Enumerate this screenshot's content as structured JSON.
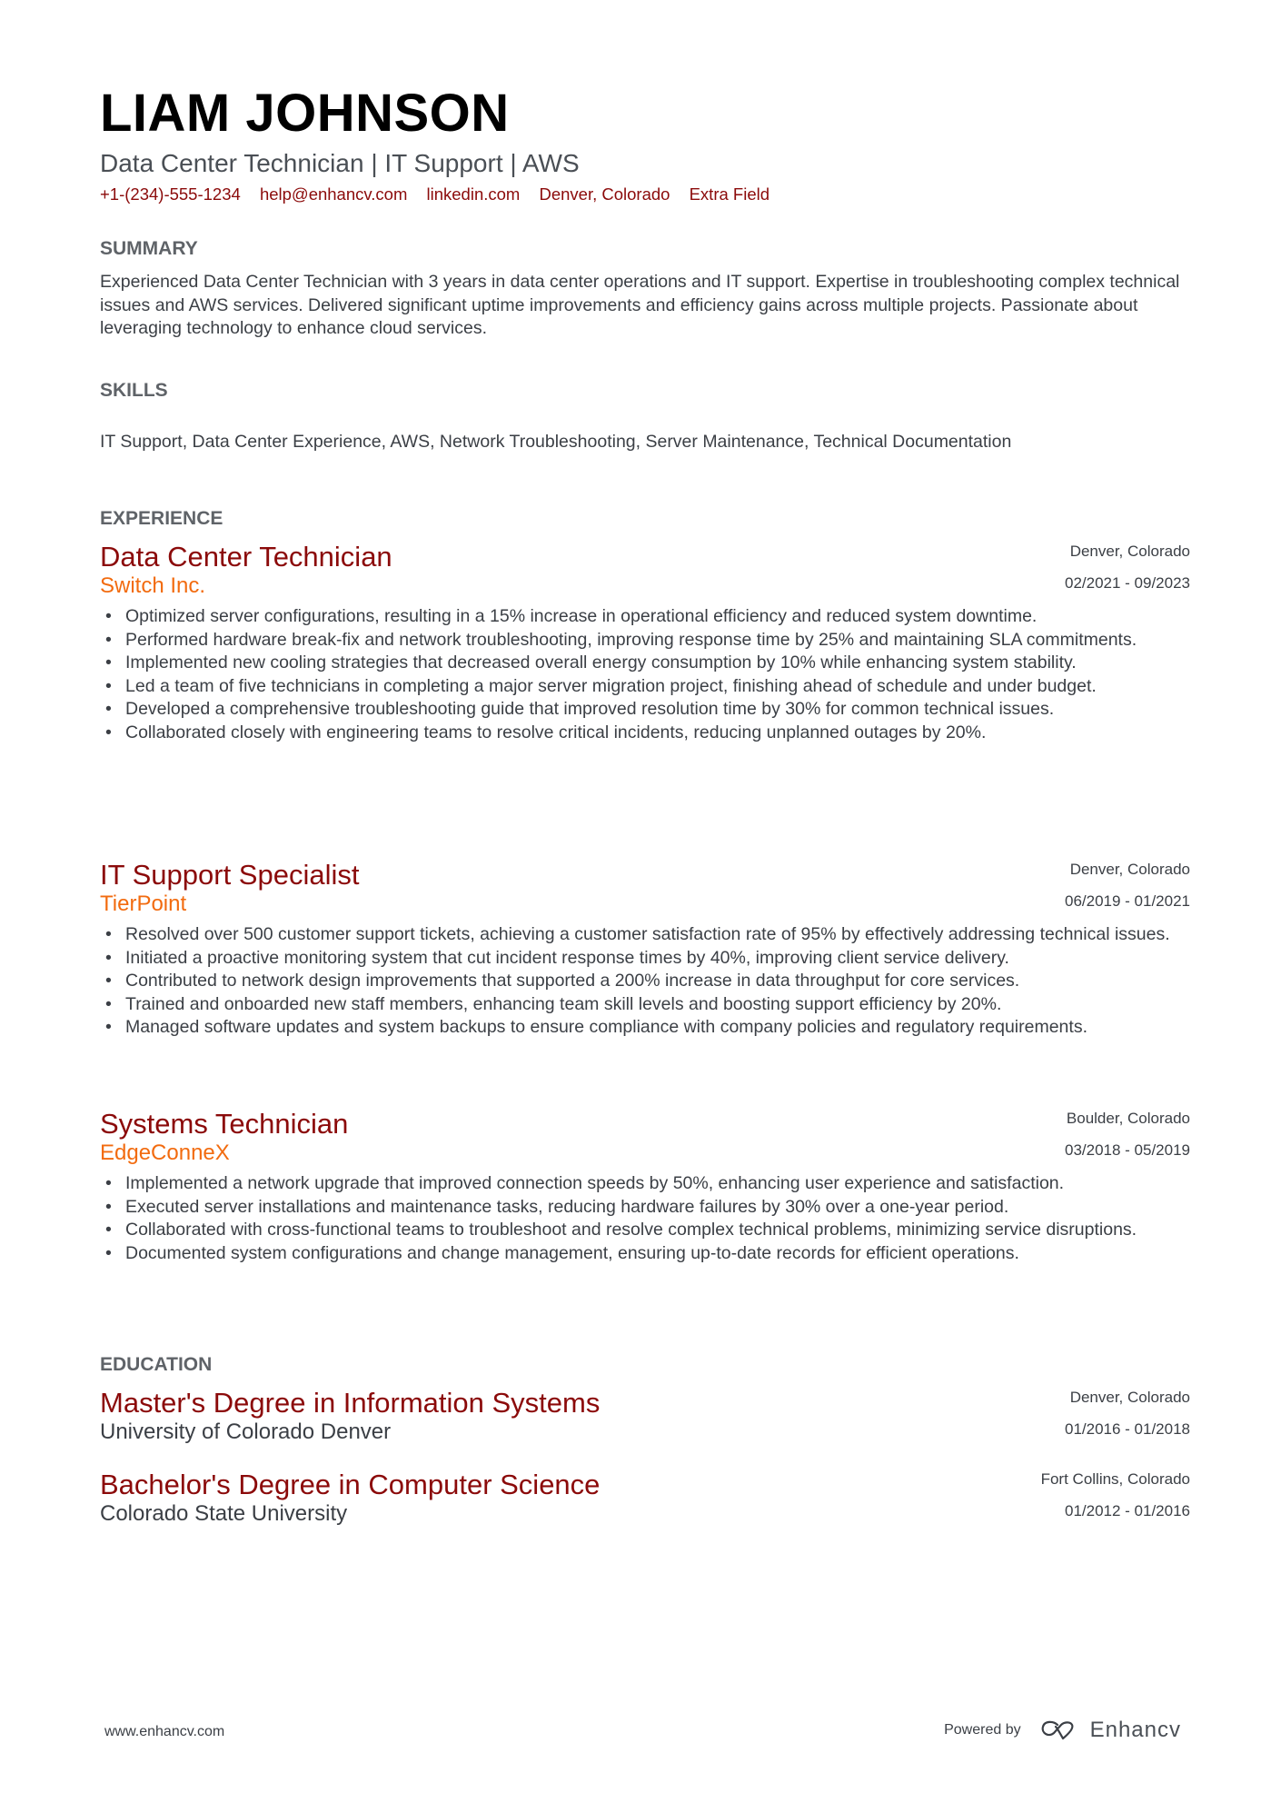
{
  "header": {
    "name": "LIAM JOHNSON",
    "subtitle": "Data Center Technician | IT Support | AWS",
    "contacts": [
      "+1-(234)-555-1234",
      "help@enhancv.com",
      "linkedin.com",
      "Denver, Colorado",
      "Extra Field"
    ]
  },
  "summary": {
    "heading": "SUMMARY",
    "text": "Experienced Data Center Technician with 3 years in data center operations and IT support. Expertise in troubleshooting complex technical issues and AWS services. Delivered significant uptime improvements and efficiency gains across multiple projects. Passionate about leveraging technology to enhance cloud services."
  },
  "skills": {
    "heading": "SKILLS",
    "text": "IT Support, Data Center Experience, AWS, Network Troubleshooting, Server Maintenance, Technical Documentation"
  },
  "experience": {
    "heading": "EXPERIENCE",
    "jobs": [
      {
        "title": "Data Center Technician",
        "company": "Switch Inc.",
        "location": "Denver, Colorado",
        "dates": "02/2021 - 09/2023",
        "bullets": [
          "Optimized server configurations, resulting in a 15% increase in operational efficiency and reduced system downtime.",
          "Performed hardware break-fix and network troubleshooting, improving response time by 25% and maintaining SLA commitments.",
          "Implemented new cooling strategies that decreased overall energy consumption by 10% while enhancing system stability.",
          "Led a team of five technicians in completing a major server migration project, finishing ahead of schedule and under budget.",
          "Developed a comprehensive troubleshooting guide that improved resolution time by 30% for common technical issues.",
          "Collaborated closely with engineering teams to resolve critical incidents, reducing unplanned outages by 20%."
        ]
      },
      {
        "title": "IT Support Specialist",
        "company": "TierPoint",
        "location": "Denver, Colorado",
        "dates": "06/2019 - 01/2021",
        "bullets": [
          "Resolved over 500 customer support tickets, achieving a customer satisfaction rate of 95% by effectively addressing technical issues.",
          "Initiated a proactive monitoring system that cut incident response times by 40%, improving client service delivery.",
          "Contributed to network design improvements that supported a 200% increase in data throughput for core services.",
          "Trained and onboarded new staff members, enhancing team skill levels and boosting support efficiency by 20%.",
          "Managed software updates and system backups to ensure compliance with company policies and regulatory requirements."
        ]
      },
      {
        "title": "Systems Technician",
        "company": "EdgeConneX",
        "location": "Boulder, Colorado",
        "dates": "03/2018 - 05/2019",
        "bullets": [
          "Implemented a network upgrade that improved connection speeds by 50%, enhancing user experience and satisfaction.",
          "Executed server installations and maintenance tasks, reducing hardware failures by 30% over a one-year period.",
          "Collaborated with cross-functional teams to troubleshoot and resolve complex technical problems, minimizing service disruptions.",
          "Documented system configurations and change management, ensuring up-to-date records for efficient operations."
        ]
      }
    ]
  },
  "education": {
    "heading": "EDUCATION",
    "items": [
      {
        "degree": "Master's Degree in Information Systems",
        "school": "University of Colorado Denver",
        "location": "Denver, Colorado",
        "dates": "01/2016 - 01/2018"
      },
      {
        "degree": "Bachelor's Degree in Computer Science",
        "school": "Colorado State University",
        "location": "Fort Collins, Colorado",
        "dates": "01/2012 - 01/2016"
      }
    ]
  },
  "footer": {
    "website": "www.enhancv.com",
    "powered_by": "Powered by",
    "brand": "Enhancv",
    "logo_icon": "enhancv-logo-icon"
  },
  "colors": {
    "accent_dark_red": "#8b0a0a",
    "accent_orange": "#f26b0f",
    "section_heading": "#5f6368",
    "body_text": "#3b3f45"
  }
}
